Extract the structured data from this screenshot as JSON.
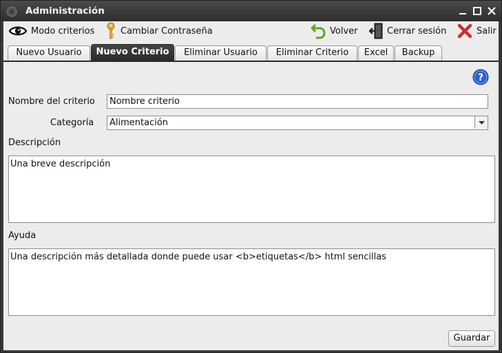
{
  "window": {
    "title": "Administración"
  },
  "toolbar": {
    "modo_criterios": "Modo criterios",
    "cambiar_contrasena": "Cambiar Contraseña",
    "volver": "Volver",
    "cerrar_sesion": "Cerrar sesión",
    "salir": "Salir"
  },
  "tabs": [
    {
      "label": "Nuevo Usuario",
      "active": false
    },
    {
      "label": "Nuevo Criterio",
      "active": true
    },
    {
      "label": "Eliminar Usuario",
      "active": false
    },
    {
      "label": "Eliminar Criterio",
      "active": false
    },
    {
      "label": "Excel",
      "active": false
    },
    {
      "label": "Backup",
      "active": false
    }
  ],
  "form": {
    "nombre_label": "Nombre del criterio",
    "nombre_value": "Nombre criterio",
    "categoria_label": "Categoría",
    "categoria_value": "Alimentación",
    "descripcion_label": "Descripción",
    "descripcion_value": "Una breve descripción",
    "ayuda_label": "Ayuda",
    "ayuda_value": "Una descripción más detallada donde puede usar <b>etiquetas</b> html sencillas",
    "guardar": "Guardar"
  },
  "colors": {
    "active_tab": "#2a2a2a",
    "help_icon": "#2c63c9",
    "close_icon": "#d62b2b",
    "back_icon": "#5aa52a",
    "key_icon": "#e7a93a"
  }
}
